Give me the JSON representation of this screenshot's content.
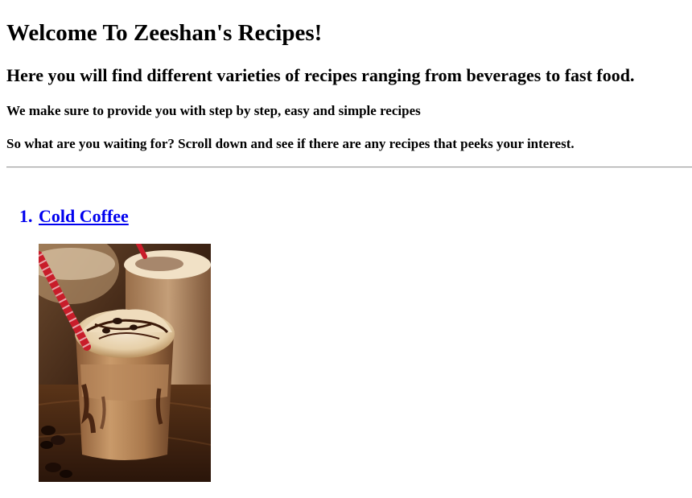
{
  "header": {
    "title": "Welcome To Zeeshan's Recipes!",
    "subtitle": "Here you will find different varieties of recipes ranging from beverages to fast food.",
    "tagline": "We make sure to provide you with step by step, easy and simple recipes",
    "call_to_action": "So what are you waiting for? Scroll down and see if there are any recipes that peeks your interest."
  },
  "recipes": [
    {
      "number": "1.",
      "name": "Cold Coffee",
      "link_color": "#0000ee"
    }
  ]
}
